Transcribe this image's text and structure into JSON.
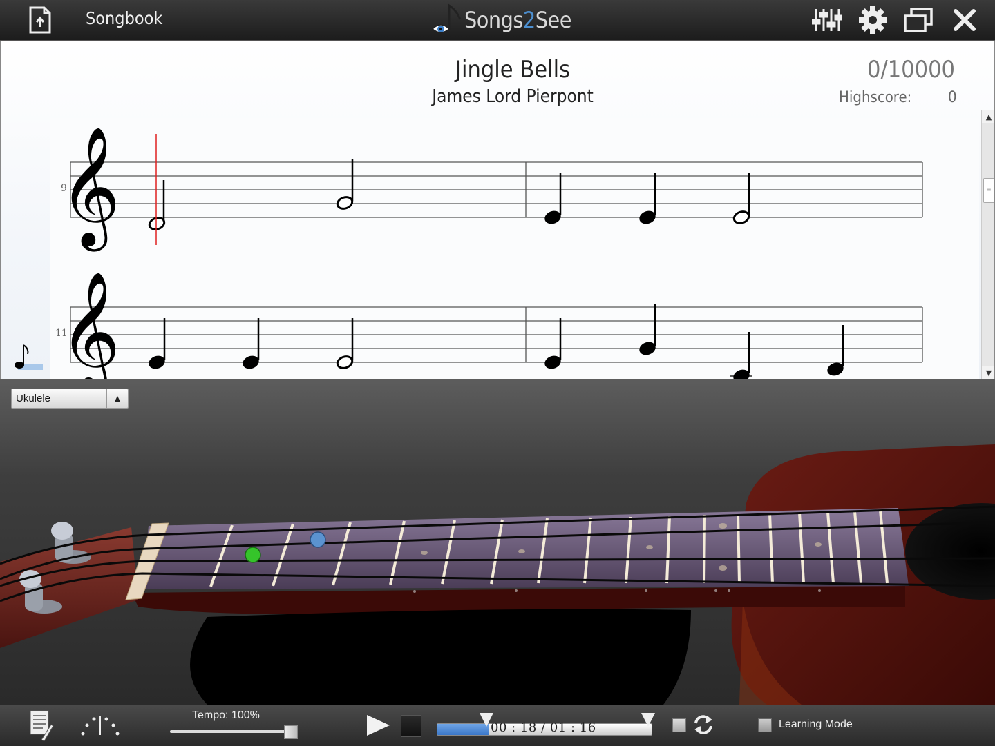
{
  "header": {
    "songbook_label": "Songbook",
    "logo_text_a": "Songs",
    "logo_text_b": "2",
    "logo_text_c": "See"
  },
  "song": {
    "title": "Jingle Bells",
    "artist": "James Lord Pierpont",
    "score": "0/10000",
    "highscore_label": "Highscore:",
    "highscore_value": "0",
    "measure_numbers": [
      "9",
      "11"
    ]
  },
  "instrument": {
    "selected": "Ukulele"
  },
  "controls": {
    "tempo_label": "Tempo:  100%",
    "tempo_percent": 100,
    "time_display": "00 : 18 / 01 : 16",
    "progress_fraction": 0.24,
    "learning_mode_label": "Learning Mode"
  },
  "colors": {
    "accent_blue": "#4c8fd0",
    "playhead": "#e02020",
    "note_green": "#35c42a",
    "note_blue": "#5b93d0"
  }
}
